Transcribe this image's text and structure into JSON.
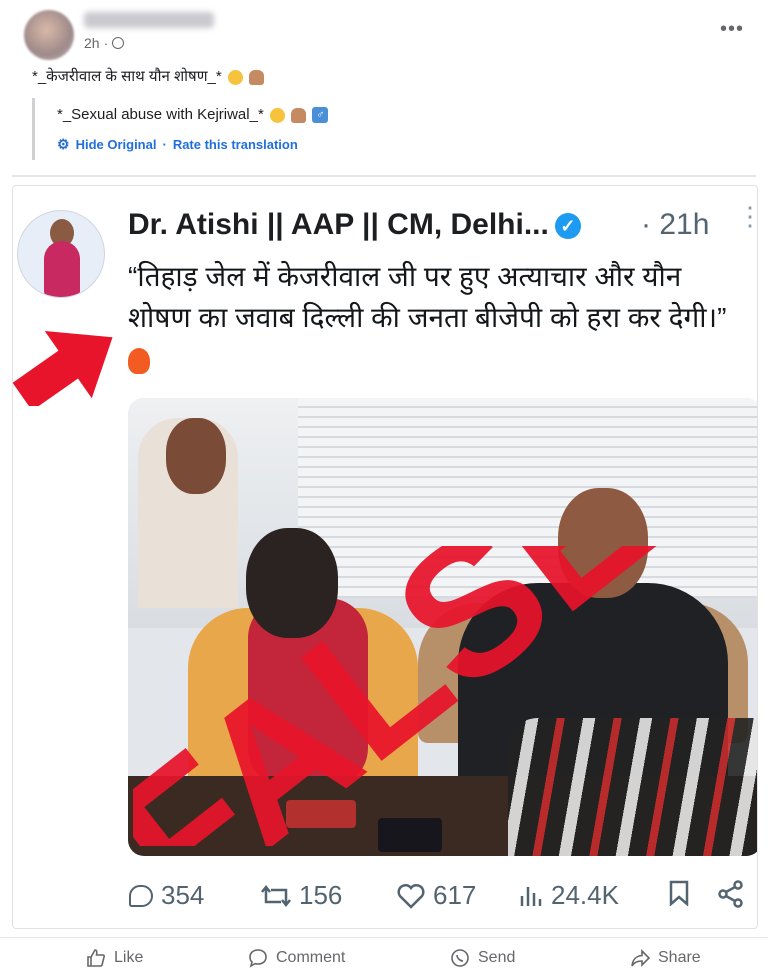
{
  "post": {
    "time": "2h",
    "privacy_icon": "globe-icon",
    "more_icon": "more-horizontal-icon",
    "text": "*_केजरीवाल के साथ यौन शोषण_*",
    "translation": {
      "text": "*_Sexual abuse with Kejriwal_*",
      "hide_label": "Hide Original",
      "separator": "·",
      "rate_label": "Rate this translation"
    }
  },
  "shared_tweet": {
    "name": "Dr. Atishi || AAP || CM, Delhi...",
    "time": "· 21h",
    "text": "“तिहाड़ जेल में केजरीवाल जी पर हुए अत्याचार और यौन शोषण का जवाब दिल्ली की जनता बीजेपी को हरा कर देगी।”",
    "stamp_text": "FALSE",
    "stats": {
      "replies": "354",
      "retweets": "156",
      "likes": "617",
      "views": "24.4K"
    }
  },
  "actions": {
    "like": "Like",
    "comment": "Comment",
    "send": "Send",
    "share": "Share"
  },
  "colors": {
    "link_blue": "#216fdb",
    "stamp_red": "#e8142b",
    "verified_blue": "#1d9bf0"
  }
}
